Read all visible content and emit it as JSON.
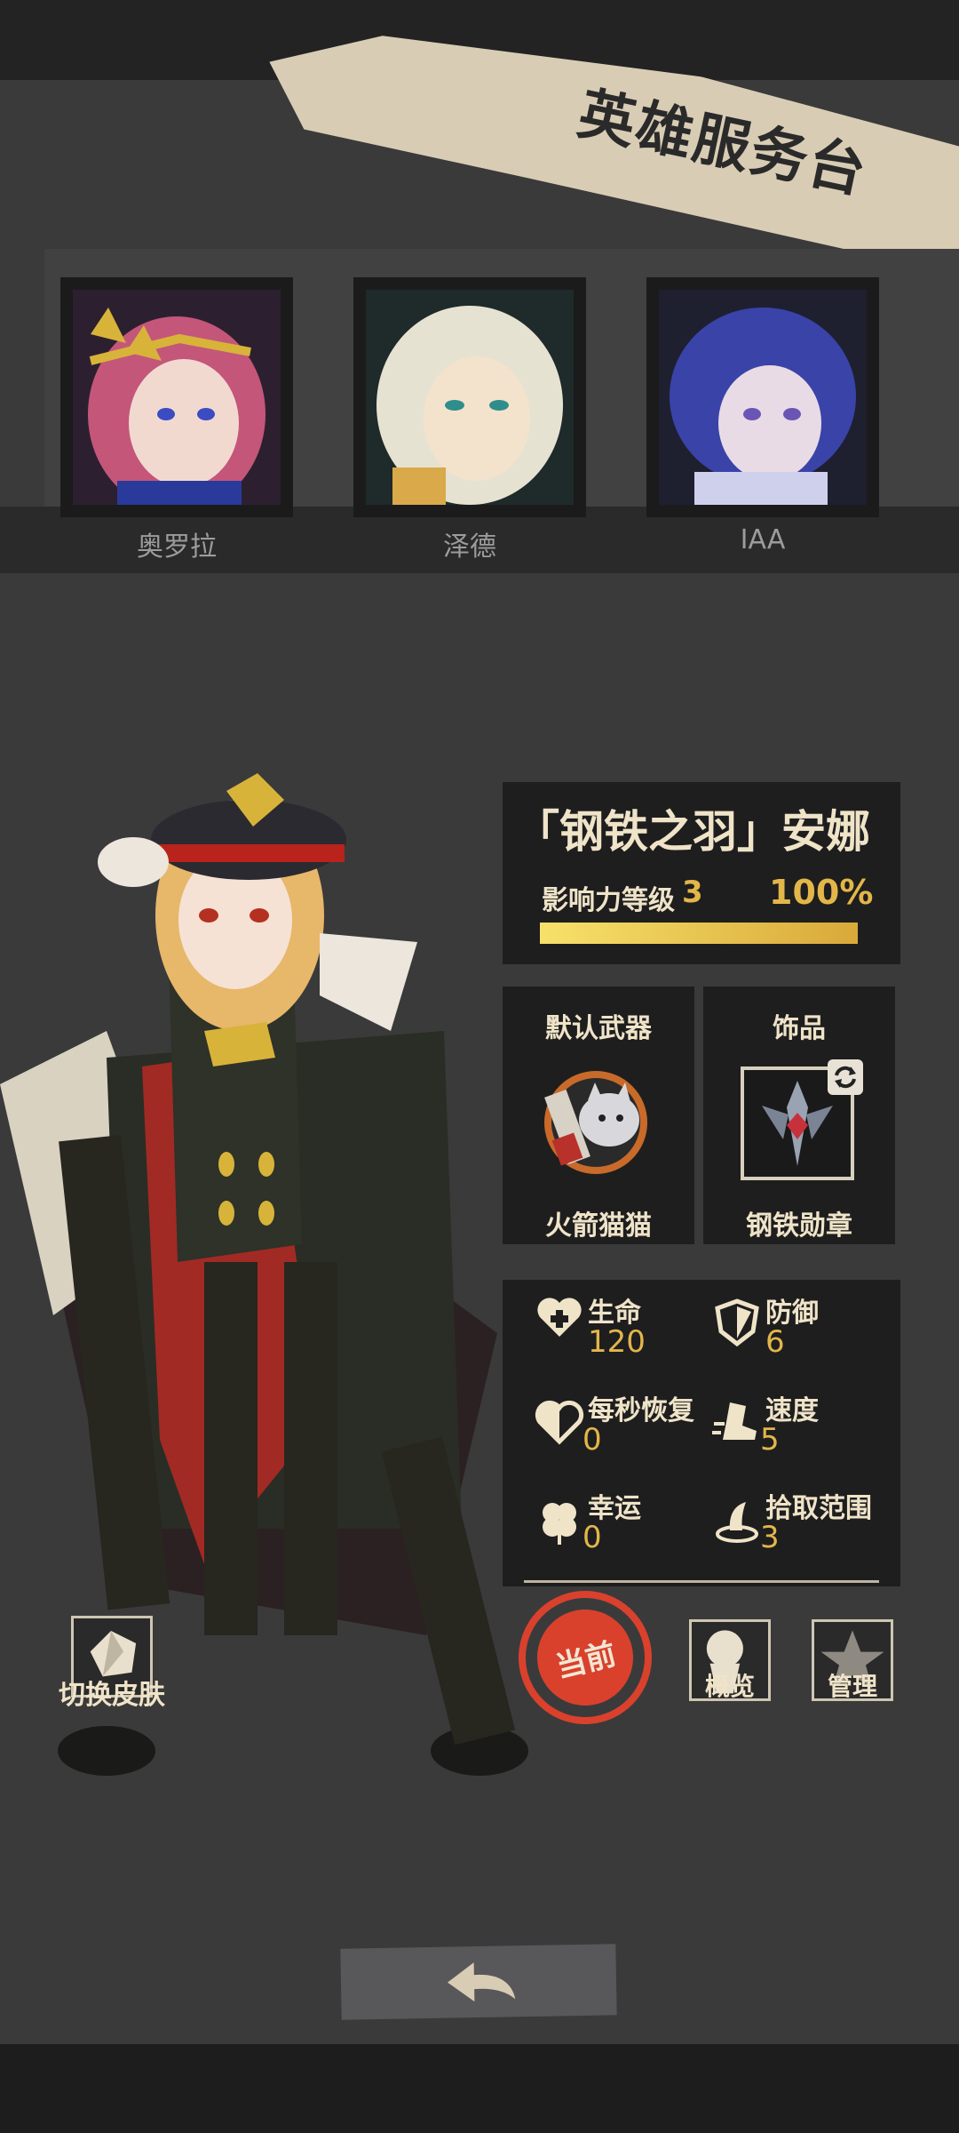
{
  "banner": {
    "title": "英雄服务台"
  },
  "heroes": [
    {
      "name": "奥罗拉",
      "icon": "hero-portrait-pink-hair"
    },
    {
      "name": "泽德",
      "icon": "hero-portrait-white-hair"
    },
    {
      "name": "IAA",
      "icon": "hero-portrait-blue-hair"
    }
  ],
  "character": {
    "title": "「钢铁之羽」安娜",
    "influence_label": "影响力等级",
    "influence_level": "3",
    "influence_percent": "100%",
    "influence_progress": 1.0
  },
  "equipment": {
    "weapon_header": "默认武器",
    "weapon_name": "火箭猫猫",
    "accessory_header": "饰品",
    "accessory_name": "钢铁勋章"
  },
  "stats": [
    {
      "label": "生命",
      "value": "120",
      "icon": "heart-cross-icon"
    },
    {
      "label": "防御",
      "value": "6",
      "icon": "shield-icon"
    },
    {
      "label": "每秒恢复",
      "value": "0",
      "icon": "heart-regen-icon"
    },
    {
      "label": "速度",
      "value": "5",
      "icon": "boot-speed-icon"
    },
    {
      "label": "幸运",
      "value": "0",
      "icon": "clover-icon"
    },
    {
      "label": "拾取范围",
      "value": "3",
      "icon": "magnet-icon"
    }
  ],
  "actions": {
    "current_label": "当前",
    "overview_label": "概览",
    "manage_label": "管理",
    "switch_skin_label": "切换皮肤"
  },
  "colors": {
    "accent": "#e3b649",
    "stamp": "#d9412d",
    "panel": "#1e1e1f",
    "text": "#efe3c8"
  }
}
